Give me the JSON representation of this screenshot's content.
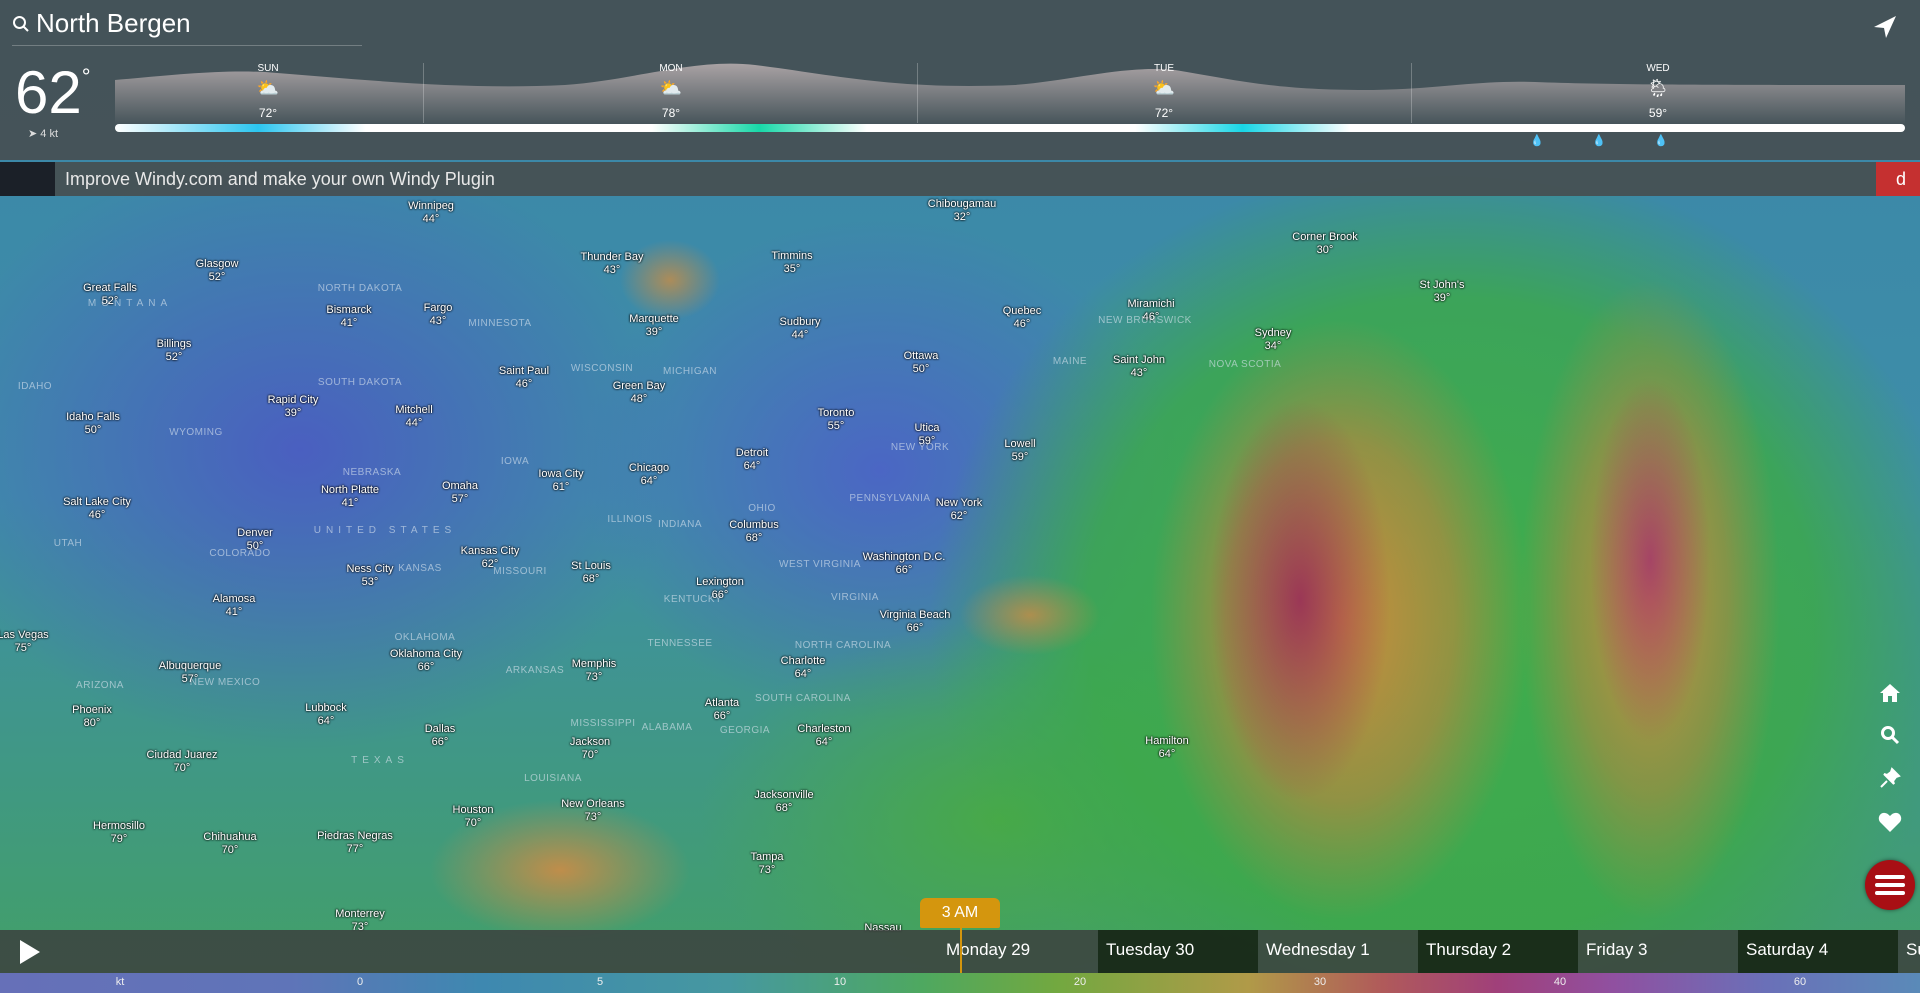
{
  "header": {
    "location": "North Bergen",
    "current_temp": "62",
    "degree": "°",
    "wind": "4 kt",
    "days": [
      {
        "label": "SUN",
        "temp": "72°",
        "icon": "partly-cloudy-icon"
      },
      {
        "label": "MON",
        "temp": "78°",
        "icon": "partly-cloudy-icon"
      },
      {
        "label": "TUE",
        "temp": "72°",
        "icon": "partly-cloudy-icon"
      },
      {
        "label": "WED",
        "temp": "59°",
        "icon": "rain-cloud-icon"
      }
    ]
  },
  "banner": {
    "text": "Improve Windy.com and make your own Windy Plugin",
    "button": "d"
  },
  "cities": [
    {
      "n": "Winnipeg",
      "t": "44°"
    },
    {
      "n": "Thunder Bay",
      "t": "43°"
    },
    {
      "n": "Timmins",
      "t": "35°"
    },
    {
      "n": "Chibougamau",
      "t": "32°"
    },
    {
      "n": "Glasgow",
      "t": "52°"
    },
    {
      "n": "Great Falls",
      "t": "52°"
    },
    {
      "n": "Bismarck",
      "t": "41°"
    },
    {
      "n": "Fargo",
      "t": "43°"
    },
    {
      "n": "Marquette",
      "t": "39°"
    },
    {
      "n": "Sudbury",
      "t": "44°"
    },
    {
      "n": "Quebec",
      "t": "46°"
    },
    {
      "n": "Ottawa",
      "t": "50°"
    },
    {
      "n": "Miramichi",
      "t": "46°"
    },
    {
      "n": "Saint John",
      "t": "43°"
    },
    {
      "n": "Sydney",
      "t": "34°"
    },
    {
      "n": "Corner Brook",
      "t": "30°"
    },
    {
      "n": "St John's",
      "t": "39°"
    },
    {
      "n": "Billings",
      "t": "52°"
    },
    {
      "n": "Saint Paul",
      "t": "46°"
    },
    {
      "n": "Green Bay",
      "t": "48°"
    },
    {
      "n": "Rapid City",
      "t": "39°"
    },
    {
      "n": "Mitchell",
      "t": "44°"
    },
    {
      "n": "Idaho Falls",
      "t": "50°"
    },
    {
      "n": "Toronto",
      "t": "55°"
    },
    {
      "n": "Utica",
      "t": "59°"
    },
    {
      "n": "Lowell",
      "t": "59°"
    },
    {
      "n": "Detroit",
      "t": "64°"
    },
    {
      "n": "Chicago",
      "t": "64°"
    },
    {
      "n": "Omaha",
      "t": "57°"
    },
    {
      "n": "Iowa City",
      "t": "61°"
    },
    {
      "n": "North Platte",
      "t": "41°"
    },
    {
      "n": "Salt Lake City",
      "t": "46°"
    },
    {
      "n": "New York",
      "t": "62°"
    },
    {
      "n": "Denver",
      "t": "50°"
    },
    {
      "n": "Columbus",
      "t": "68°"
    },
    {
      "n": "Washington D.C.",
      "t": "66°"
    },
    {
      "n": "Kansas City",
      "t": "62°"
    },
    {
      "n": "St Louis",
      "t": "68°"
    },
    {
      "n": "Ness City",
      "t": "53°"
    },
    {
      "n": "Lexington",
      "t": "66°"
    },
    {
      "n": "Alamosa",
      "t": "41°"
    },
    {
      "n": "Virginia Beach",
      "t": "66°"
    },
    {
      "n": "Las Vegas",
      "t": "75°"
    },
    {
      "n": "Oklahoma City",
      "t": "66°"
    },
    {
      "n": "Memphis",
      "t": "73°"
    },
    {
      "n": "Charlotte",
      "t": "64°"
    },
    {
      "n": "Albuquerque",
      "t": "57°"
    },
    {
      "n": "Atlanta",
      "t": "66°"
    },
    {
      "n": "Phoenix",
      "t": "80°"
    },
    {
      "n": "Lubbock",
      "t": "64°"
    },
    {
      "n": "Dallas",
      "t": "66°"
    },
    {
      "n": "Charleston",
      "t": "64°"
    },
    {
      "n": "Jackson",
      "t": "70°"
    },
    {
      "n": "Hamilton",
      "t": "64°"
    },
    {
      "n": "Ciudad Juarez",
      "t": "70°"
    },
    {
      "n": "Jacksonville",
      "t": "68°"
    },
    {
      "n": "Houston",
      "t": "70°"
    },
    {
      "n": "New Orleans",
      "t": "73°"
    },
    {
      "n": "Hermosillo",
      "t": "79°"
    },
    {
      "n": "Chihuahua",
      "t": "70°"
    },
    {
      "n": "Piedras Negras",
      "t": "77°"
    },
    {
      "n": "Tampa",
      "t": "73°"
    },
    {
      "n": "Monterrey",
      "t": "73°"
    },
    {
      "n": "Nassau",
      "t": ""
    }
  ],
  "states": [
    "MONTANA",
    "NORTH DAKOTA",
    "SOUTH DAKOTA",
    "MINNESOTA",
    "WISCONSIN",
    "MICHIGAN",
    "IDAHO",
    "WYOMING",
    "NEBRASKA",
    "IOWA",
    "ILLINOIS",
    "INDIANA",
    "OHIO",
    "PENNSYLVANIA",
    "NEW YORK",
    "MAINE",
    "NEW BRUNSWICK",
    "NOVA SCOTIA",
    "UTAH",
    "COLORADO",
    "KANSAS",
    "MISSOURI",
    "UNITED STATES",
    "KENTUCKY",
    "WEST VIRGINIA",
    "VIRGINIA",
    "TENNESSEE",
    "NORTH CAROLINA",
    "OKLAHOMA",
    "ARKANSAS",
    "ARIZONA",
    "NEW MEXICO",
    "TEXAS",
    "MISSISSIPPI",
    "ALABAMA",
    "GEORGIA",
    "SOUTH CAROLINA",
    "LOUISIANA"
  ],
  "timeline": {
    "current_time": "3 AM",
    "days": [
      "Monday 29",
      "Tuesday 30",
      "Wednesday 1",
      "Thursday 2",
      "Friday 3",
      "Saturday 4",
      "Su"
    ]
  },
  "legend": {
    "unit": "kt",
    "values": [
      "0",
      "5",
      "10",
      "20",
      "30",
      "40",
      "60"
    ]
  },
  "colors": {
    "accent": "#d4960e",
    "menu": "#a80f14",
    "banner_button": "#c53030"
  }
}
